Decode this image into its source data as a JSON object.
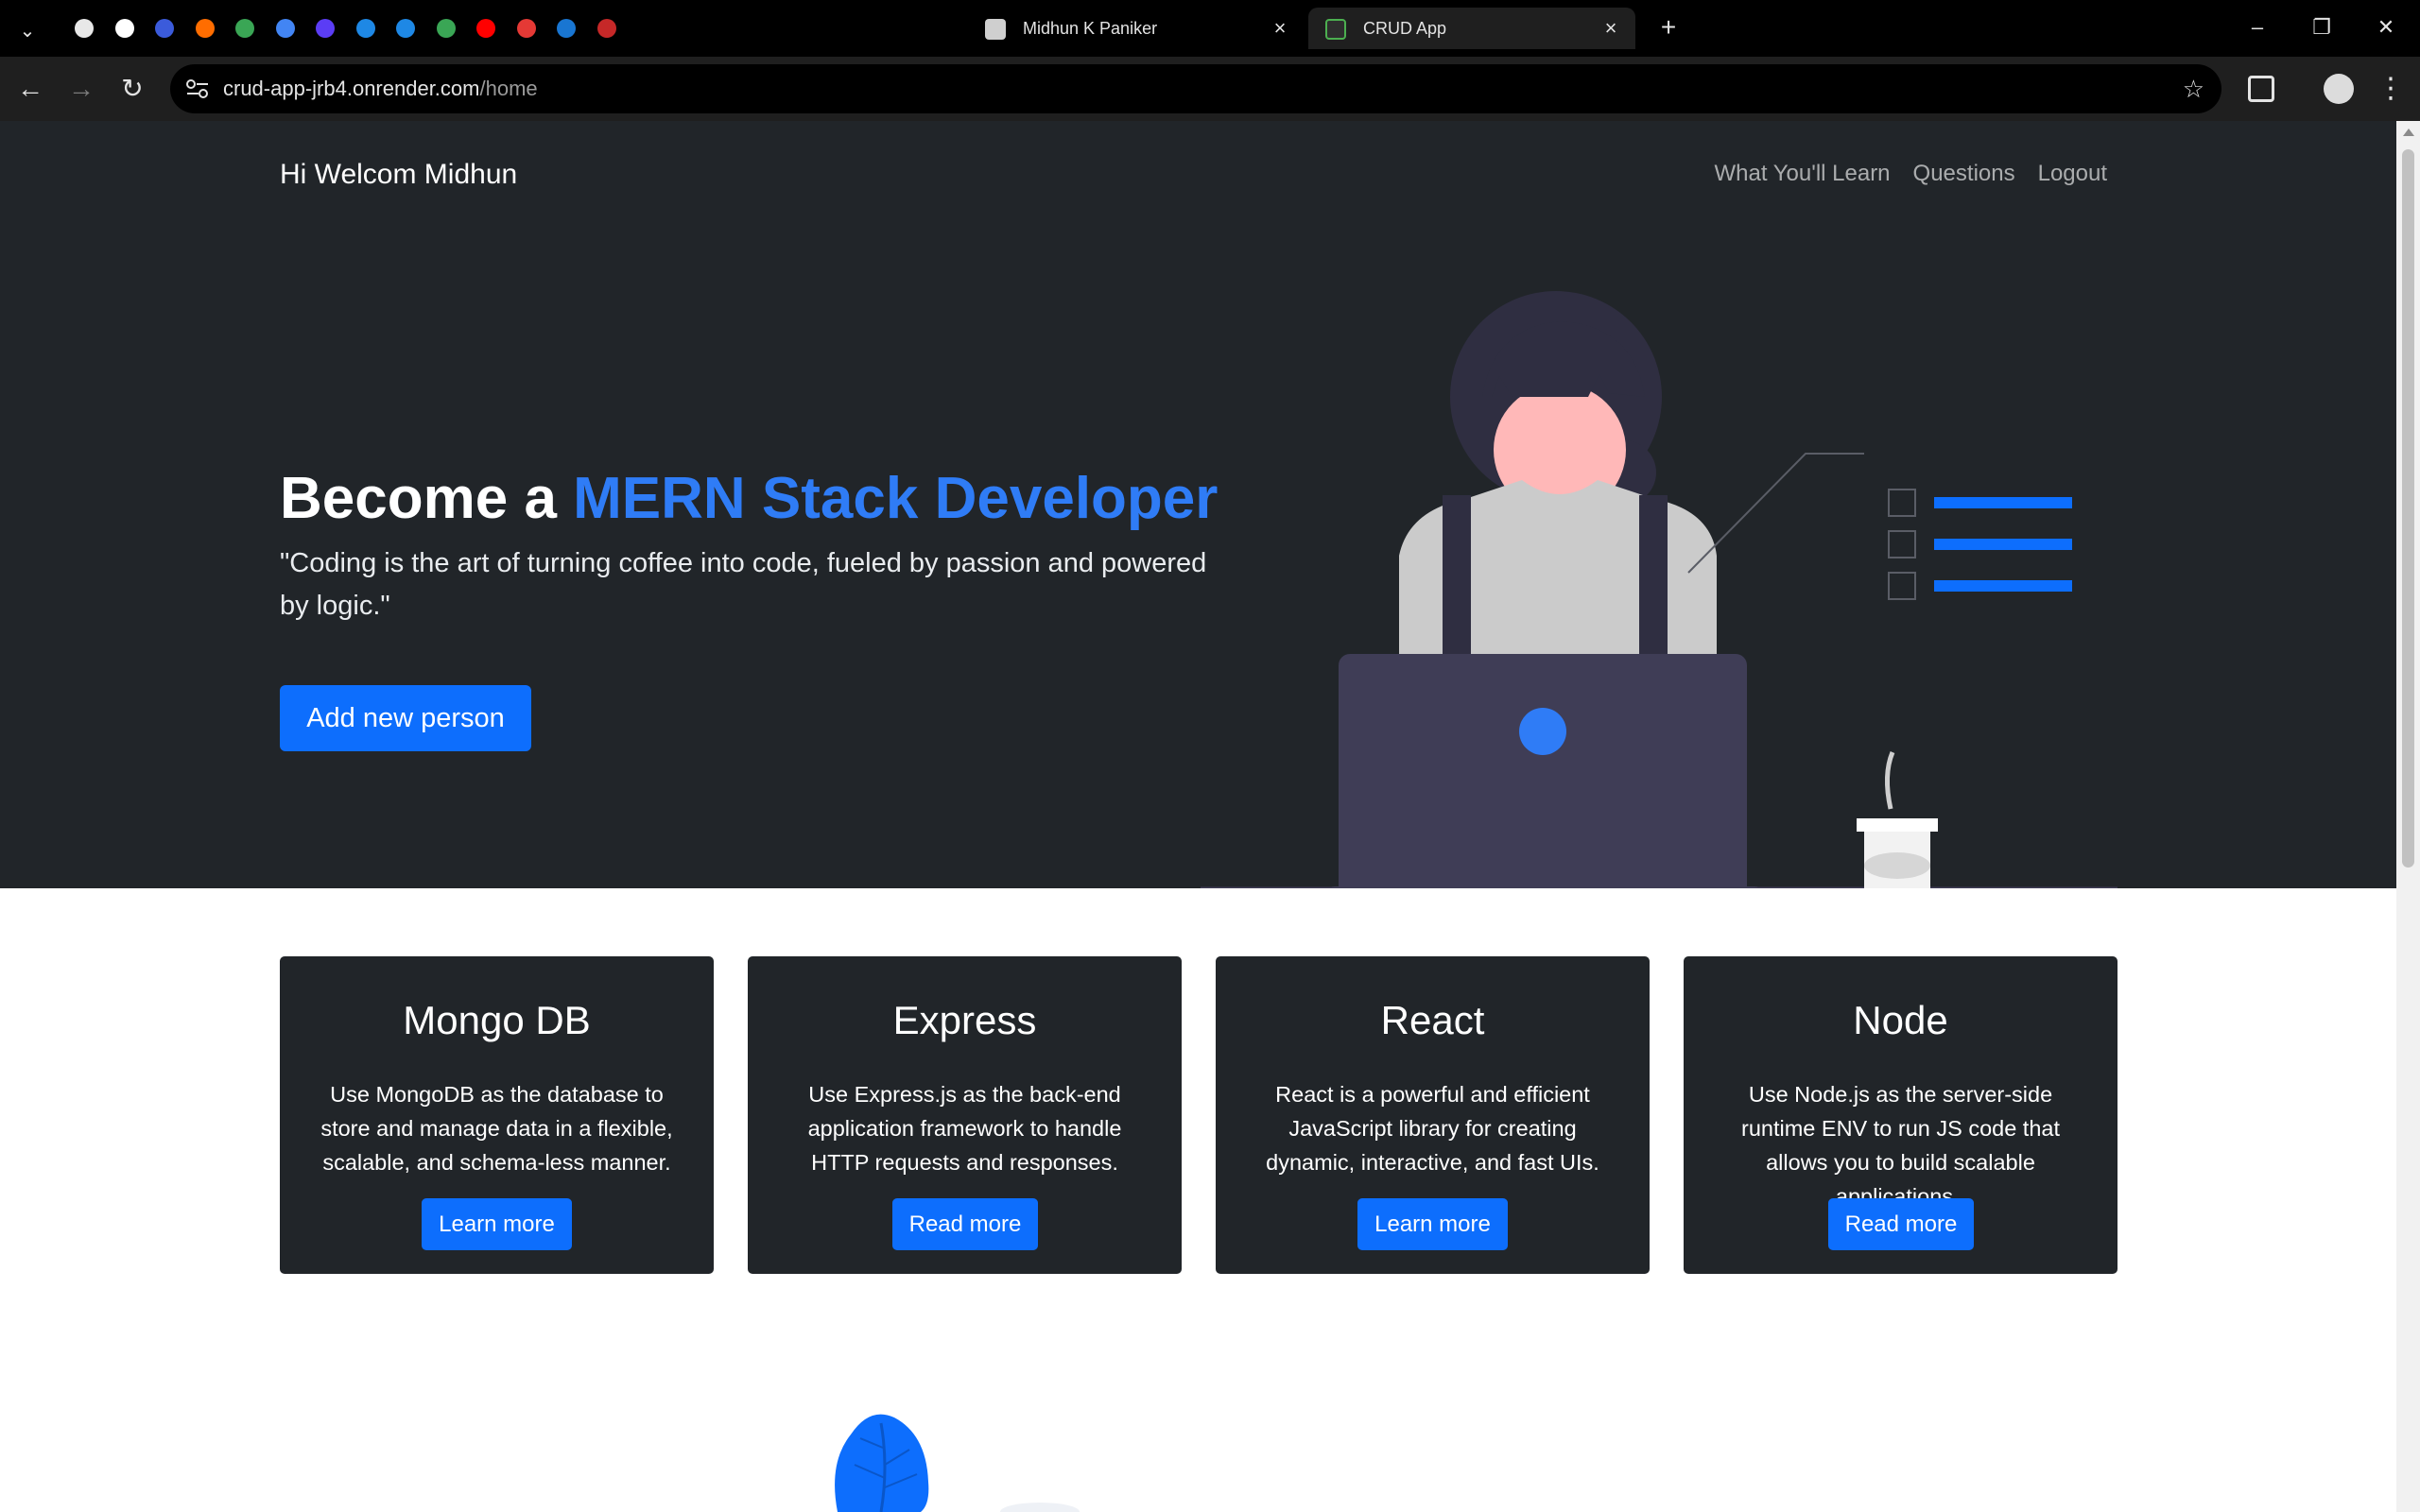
{
  "browser": {
    "pinned_tabs": [
      {
        "icon": "spiral-app-icon",
        "color": "#e8e8e8"
      },
      {
        "icon": "network-app-icon",
        "color": "#ffffff"
      },
      {
        "icon": "chart-app-icon",
        "color": "#3b5bdb"
      },
      {
        "icon": "firebase-icon",
        "color": "#ff6d00"
      },
      {
        "icon": "globe-icon",
        "color": "#3aa655"
      },
      {
        "icon": "google-docs-icon",
        "color": "#4285f4"
      },
      {
        "icon": "dashboard-app-icon",
        "color": "#5b3df5"
      },
      {
        "icon": "circle-app-icon",
        "color": "#1e88e5"
      },
      {
        "icon": "circle-app-icon",
        "color": "#1e88e5"
      },
      {
        "icon": "globe-icon",
        "color": "#3aa655"
      },
      {
        "icon": "youtube-icon",
        "color": "#ff0000"
      },
      {
        "icon": "bird-app-icon",
        "color": "#e53935"
      },
      {
        "icon": "e-app-icon",
        "color": "#1976d2"
      },
      {
        "icon": "m-app-icon",
        "color": "#c62828"
      }
    ],
    "tabs": [
      {
        "title": "Midhun K Paniker",
        "active": false,
        "favicon": "person-favicon-icon",
        "favicon_color": "#cfcfcf"
      },
      {
        "title": "CRUD App",
        "active": true,
        "favicon": "crud-app-favicon-icon",
        "favicon_color": "#4caf50"
      }
    ],
    "url_host": "crud-app-jrb4.onrender.com",
    "url_path": "/home"
  },
  "navbar": {
    "brand": "Hi Welcom Midhun",
    "links": [
      "What You'll Learn",
      "Questions",
      "Logout"
    ]
  },
  "hero": {
    "headline_prefix": "Become a ",
    "headline_accent": "MERN Stack Developer",
    "quote": "\"Coding is the art of turning coffee into code, fueled by passion and powered by logic.\"",
    "cta": "Add new person",
    "accent_color": "#2f7cf6"
  },
  "cards": [
    {
      "title": "Mongo DB",
      "text": "Use MongoDB as the database to store and manage data in a flexible, scalable, and schema-less manner.",
      "button": "Learn more"
    },
    {
      "title": "Express",
      "text": "Use Express.js as the back-end application framework to handle HTTP requests and responses.",
      "button": "Read more"
    },
    {
      "title": "React",
      "text": "React is a powerful and efficient JavaScript library for creating dynamic, interactive, and fast UIs.",
      "button": "Learn more"
    },
    {
      "title": "Node",
      "text": "Use Node.js as the server-side runtime ENV to run JS code that allows you to build scalable applications..",
      "button": "Read more"
    }
  ],
  "colors": {
    "hero_bg": "#212529",
    "primary_button": "#0d6efd",
    "card_bg": "#212529"
  }
}
